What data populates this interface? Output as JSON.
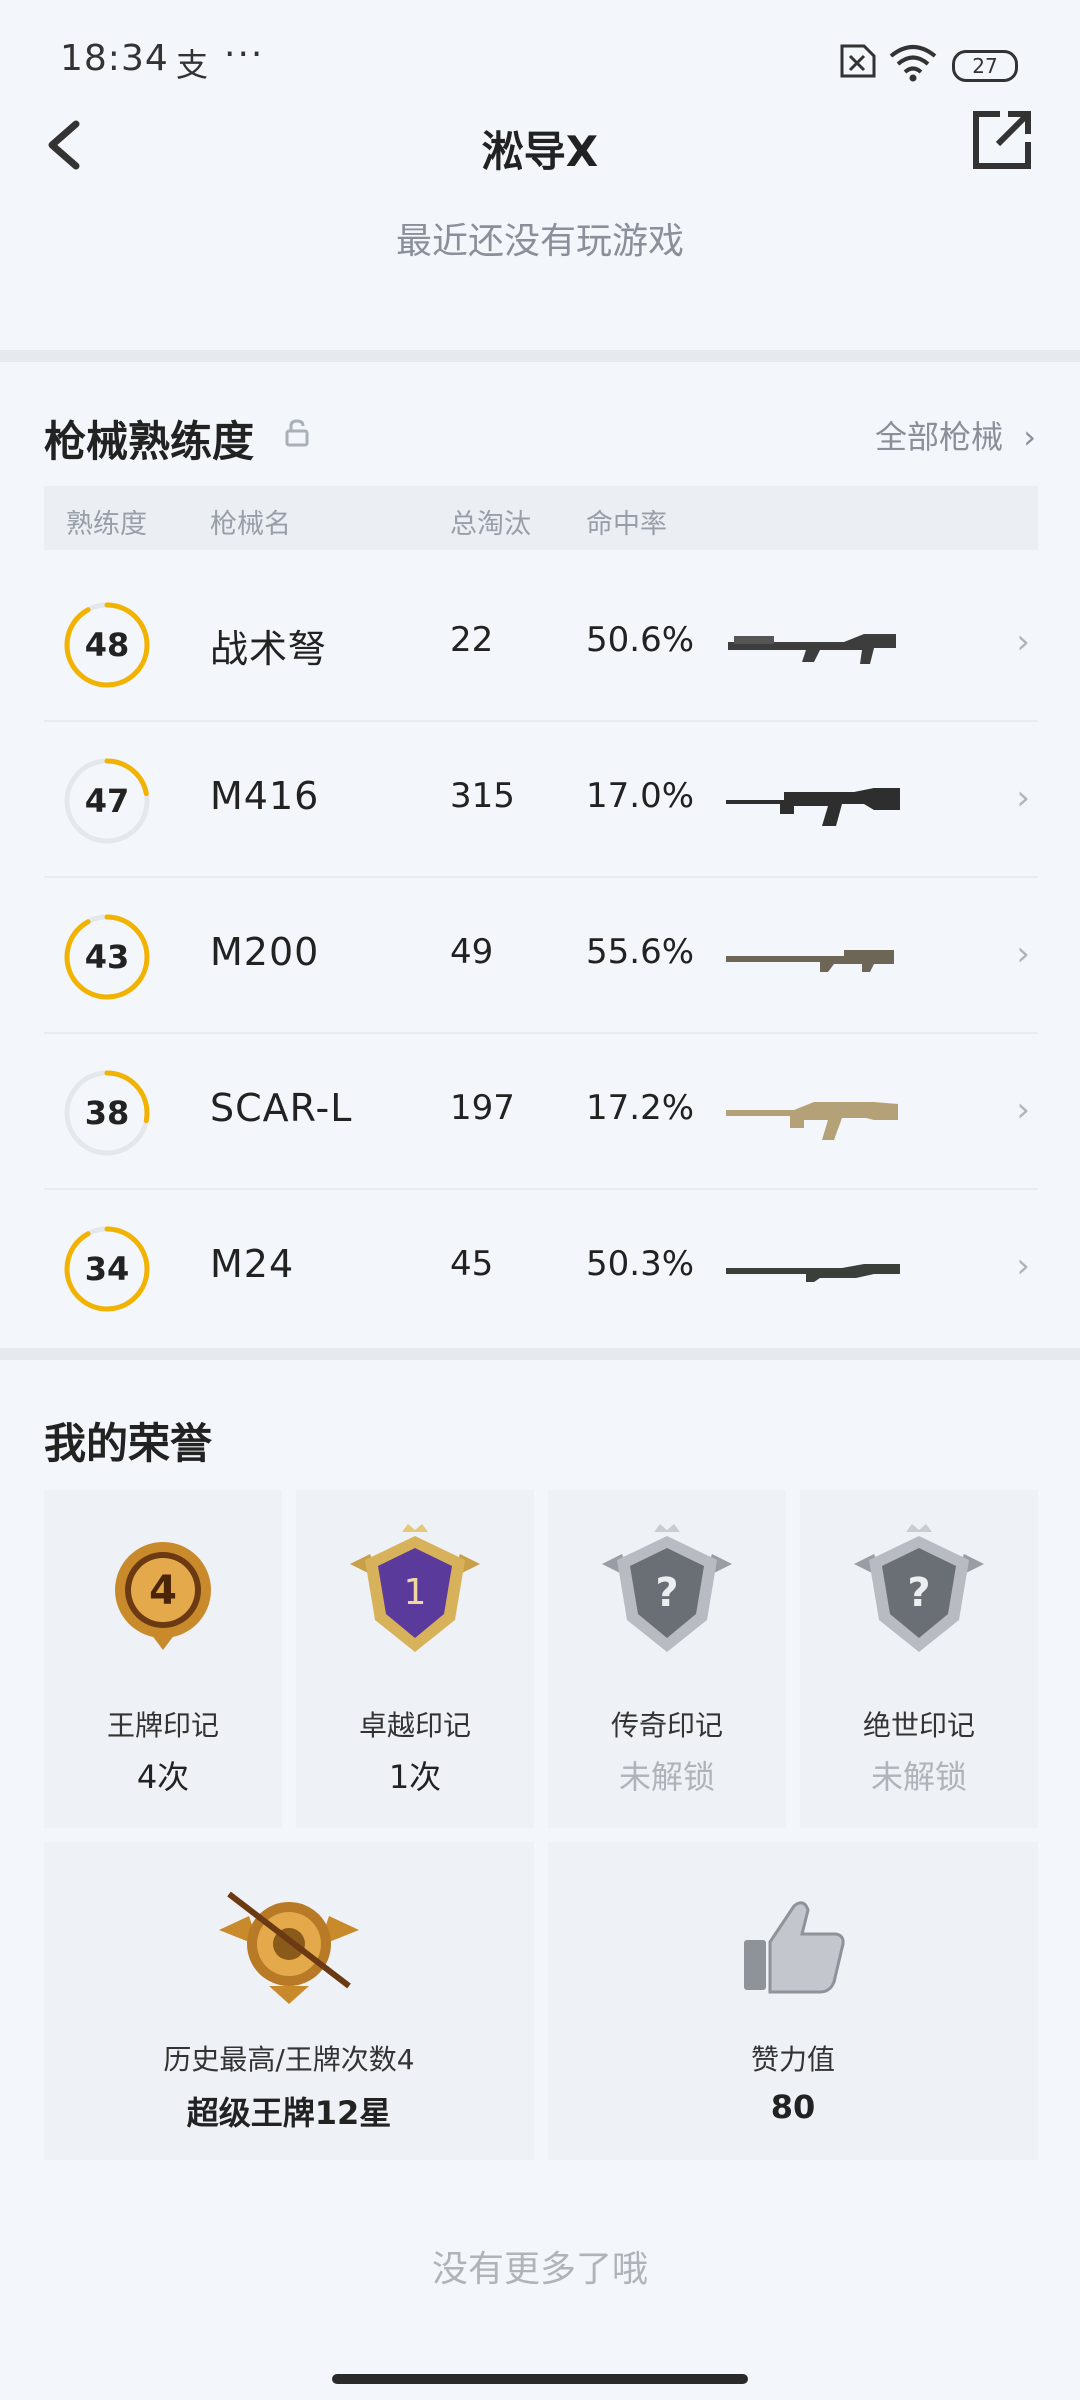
{
  "status_bar": {
    "time": "18:34",
    "alipay_glyph": "支",
    "more_glyph": "···",
    "battery": "27"
  },
  "header": {
    "title": "淞导X",
    "subtitle": "最近还没有玩游戏"
  },
  "weapons": {
    "section_title": "枪械熟练度",
    "all_link": "全部枪械",
    "columns": [
      "熟练度",
      "枪械名",
      "总淘汰",
      "命中率"
    ],
    "rows": [
      {
        "level": "48",
        "progress": 0.92,
        "name": "战术弩",
        "kills": "22",
        "rate": "50.6%"
      },
      {
        "level": "47",
        "progress": 0.22,
        "name": "M416",
        "kills": "315",
        "rate": "17.0%"
      },
      {
        "level": "43",
        "progress": 0.92,
        "name": "M200",
        "kills": "49",
        "rate": "55.6%"
      },
      {
        "level": "38",
        "progress": 0.28,
        "name": "SCAR-L",
        "kills": "197",
        "rate": "17.2%"
      },
      {
        "level": "34",
        "progress": 0.92,
        "name": "M24",
        "kills": "45",
        "rate": "50.3%"
      }
    ]
  },
  "honors": {
    "section_title": "我的荣誉",
    "badges": [
      {
        "label": "王牌印记",
        "value": "4次",
        "locked": false,
        "emblem": "4"
      },
      {
        "label": "卓越印记",
        "value": "1次",
        "locked": false,
        "emblem": "1"
      },
      {
        "label": "传奇印记",
        "value": "未解锁",
        "locked": true,
        "emblem": "?"
      },
      {
        "label": "绝世印记",
        "value": "未解锁",
        "locked": true,
        "emblem": "?"
      }
    ],
    "highest": {
      "label": "历史最高/王牌次数4",
      "value": "超级王牌12星"
    },
    "likes": {
      "label": "赞力值",
      "value": "80"
    }
  },
  "footer": {
    "no_more": "没有更多了哦"
  },
  "colors": {
    "accent": "#f2b300",
    "background": "#f3f6fa",
    "muted": "#8a8f99"
  }
}
